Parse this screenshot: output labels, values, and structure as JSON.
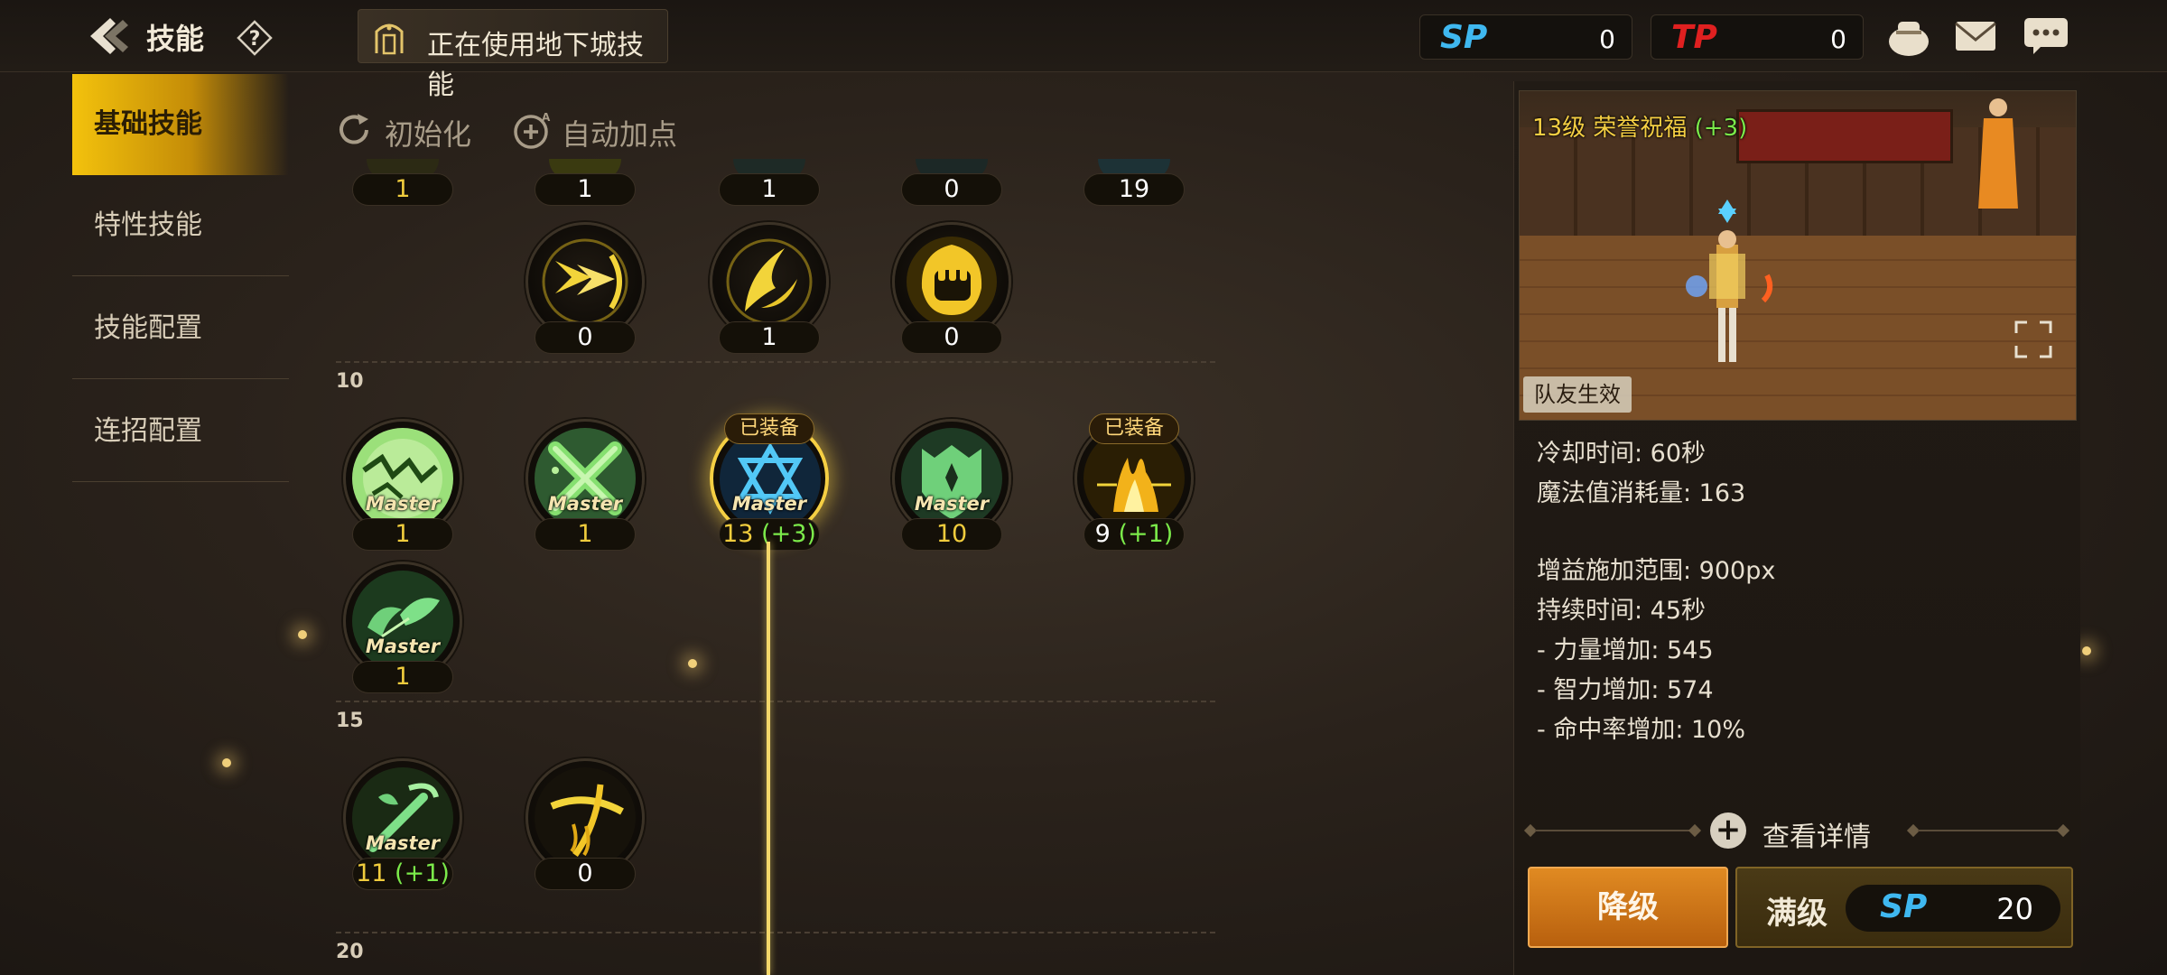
{
  "header": {
    "title": "技能",
    "dungeon_mode": "正在使用地下城技能",
    "sp": {
      "label": "SP",
      "value": "0"
    },
    "tp": {
      "label": "TP",
      "value": "0"
    }
  },
  "sidebar": {
    "tabs": [
      {
        "label": "基础技能",
        "active": true
      },
      {
        "label": "特性技能",
        "active": false
      },
      {
        "label": "技能配置",
        "active": false
      },
      {
        "label": "连招配置",
        "active": false
      }
    ]
  },
  "tools": {
    "reset": "初始化",
    "auto": "自动加点"
  },
  "skills": {
    "top_row": [
      "1",
      "1",
      "1",
      "0",
      "19"
    ],
    "level_labels": [
      "10",
      "15",
      "20"
    ],
    "row1": [
      "0",
      "1",
      "0"
    ],
    "master_text": "Master",
    "equipped_text": "已装备",
    "row2": [
      {
        "level": "1",
        "bonus": "",
        "master": true,
        "equipped": false
      },
      {
        "level": "1",
        "bonus": "",
        "master": true,
        "equipped": false
      },
      {
        "level": "13",
        "bonus": "(+3)",
        "master": true,
        "equipped": true
      },
      {
        "level": "10",
        "bonus": "",
        "master": true,
        "equipped": false
      },
      {
        "level": "9",
        "bonus": "(+1)",
        "master": false,
        "equipped": true
      }
    ],
    "row3": [
      {
        "level": "1",
        "master": true
      }
    ],
    "row4": [
      {
        "level": "11",
        "bonus": "(+1)",
        "master": true
      },
      {
        "level": "0",
        "bonus": "",
        "master": false
      }
    ]
  },
  "detail": {
    "skill_name": "13级 荣誉祝福",
    "skill_bonus": "(+3)",
    "party_badge": "队友生效",
    "stats": [
      "冷却时间: 60秒",
      "魔法值消耗量: 163",
      "增益施加范围: 900px",
      "持续时间: 45秒",
      "- 力量增加: 545",
      "- 智力增加: 574",
      "- 命中率增加: 10%"
    ],
    "view_details": "查看详情",
    "downgrade": "降级",
    "max_level": "满级",
    "cost": {
      "label": "SP",
      "value": "20"
    }
  },
  "colors": {
    "gold": "#f5cf43",
    "bonus_green": "#7bea4a",
    "sp_blue": "#3fb8f0",
    "tp_red": "#e02020",
    "orange_button": "#d67a1a"
  }
}
